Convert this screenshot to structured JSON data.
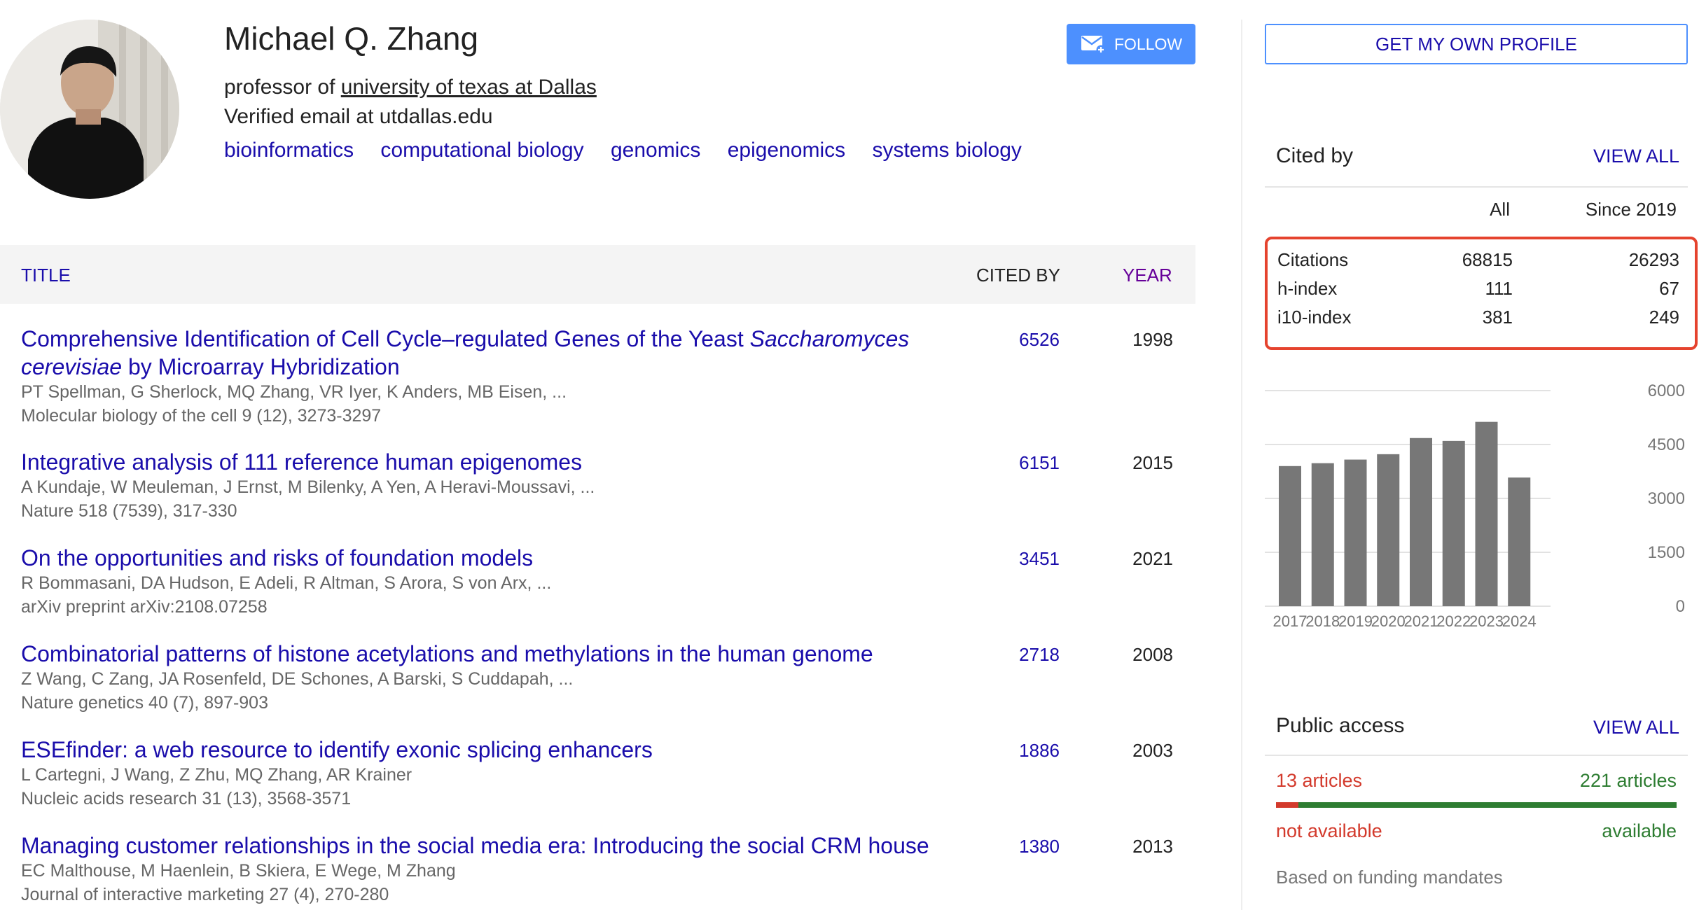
{
  "profile": {
    "name": "Michael Q. Zhang",
    "affiliation_prefix": "professor of ",
    "affiliation_institution": "university of texas at Dallas",
    "email": "Verified email at utdallas.edu",
    "interests": [
      "bioinformatics",
      "computational biology",
      "genomics",
      "epigenomics",
      "systems biology"
    ],
    "follow_label": "FOLLOW"
  },
  "table": {
    "col_title": "TITLE",
    "col_cited": "CITED BY",
    "col_year": "YEAR",
    "rows": [
      {
        "title_html": "Comprehensive Identification of Cell Cycle–regulated Genes of the Yeast <i>Saccharomyces cerevisiae</i> by Microarray Hybridization",
        "authors": "PT Spellman, G Sherlock, MQ Zhang, VR Iyer, K Anders, MB Eisen, ...",
        "venue": "Molecular biology of the cell 9 (12), 3273-3297",
        "cited": "6526",
        "year": "1998"
      },
      {
        "title_html": "Integrative analysis of 111 reference human epigenomes",
        "authors": "A Kundaje, W Meuleman, J Ernst, M Bilenky, A Yen, A Heravi-Moussavi, ...",
        "venue": "Nature 518 (7539), 317-330",
        "cited": "6151",
        "year": "2015"
      },
      {
        "title_html": "On the opportunities and risks of foundation models",
        "authors": "R Bommasani, DA Hudson, E Adeli, R Altman, S Arora, S von Arx, ...",
        "venue": "arXiv preprint arXiv:2108.07258",
        "cited": "3451",
        "year": "2021"
      },
      {
        "title_html": "Combinatorial patterns of histone acetylations and methylations in the human genome",
        "authors": "Z Wang, C Zang, JA Rosenfeld, DE Schones, A Barski, S Cuddapah, ...",
        "venue": "Nature genetics 40 (7), 897-903",
        "cited": "2718",
        "year": "2008"
      },
      {
        "title_html": "ESEfinder: a web resource to identify exonic splicing enhancers",
        "authors": "L Cartegni, J Wang, Z Zhu, MQ Zhang, AR Krainer",
        "venue": "Nucleic acids research 31 (13), 3568-3571",
        "cited": "1886",
        "year": "2003"
      },
      {
        "title_html": "Managing customer relationships in the social media era: Introducing the social CRM house",
        "authors": "EC Malthouse, M Haenlein, B Skiera, E Wege, M Zhang",
        "venue": "Journal of interactive marketing 27 (4), 270-280",
        "cited": "1380",
        "year": "2013"
      }
    ]
  },
  "sidebar": {
    "own_profile_label": "GET MY OWN PROFILE",
    "cited_by": {
      "title": "Cited by",
      "view_all": "VIEW ALL",
      "col_all": "All",
      "col_since": "Since 2019",
      "rows": [
        {
          "label": "Citations",
          "all": "68815",
          "since": "26293"
        },
        {
          "label": "h-index",
          "all": "111",
          "since": "67"
        },
        {
          "label": "i10-index",
          "all": "381",
          "since": "249"
        }
      ]
    },
    "public_access": {
      "title": "Public access",
      "view_all": "VIEW ALL",
      "not_available_count": "13 articles",
      "available_count": "221 articles",
      "not_available_label": "not available",
      "available_label": "available",
      "not_available_fraction": 0.056,
      "note": "Based on funding mandates"
    }
  },
  "colors": {
    "link": "#1a0dab",
    "accent_blue": "#4d90fe",
    "highlight_red": "#e5432e",
    "not_available_red": "#d33a2c",
    "available_green": "#2e7d32",
    "bar_gray": "#777777"
  },
  "chart_data": {
    "type": "bar",
    "categories": [
      "2017",
      "2018",
      "2019",
      "2020",
      "2021",
      "2022",
      "2023",
      "2024"
    ],
    "values": [
      3900,
      3980,
      4080,
      4230,
      4680,
      4600,
      5130,
      3580
    ],
    "yticks": [
      "6000",
      "4500",
      "3000",
      "1500",
      "0"
    ],
    "ylim": [
      0,
      6000
    ],
    "grid": true
  }
}
